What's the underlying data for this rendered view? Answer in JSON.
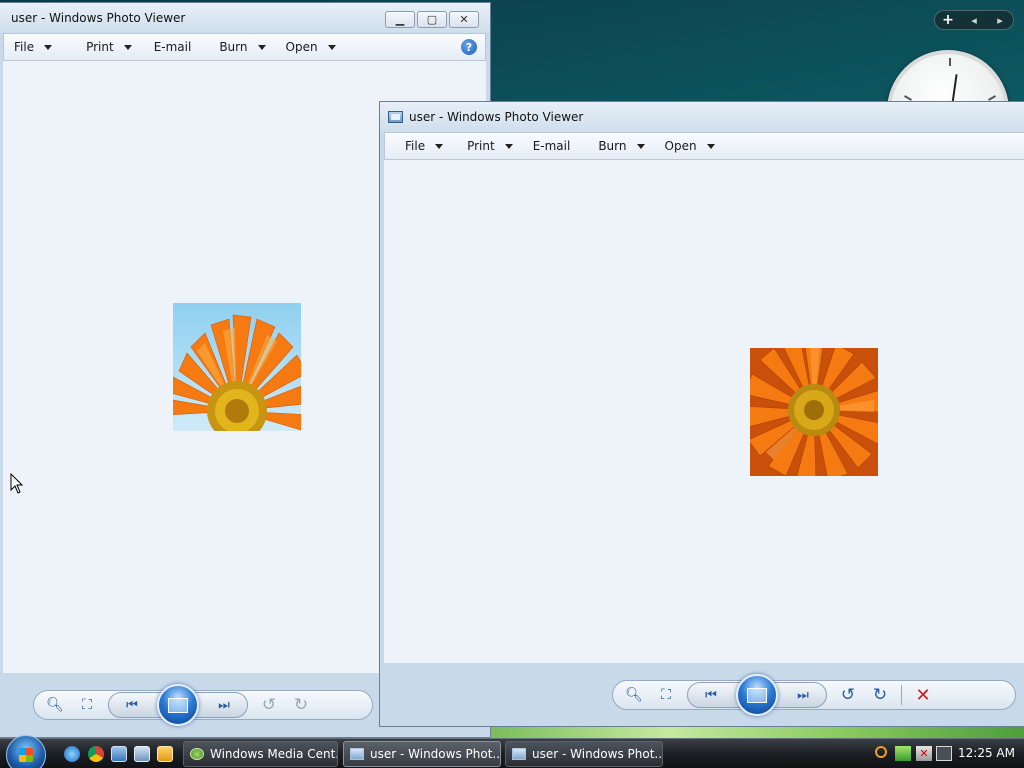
{
  "desktop": {
    "gadget_bar": {
      "add_label": "+",
      "prev_label": "◂",
      "next_label": "▸"
    }
  },
  "window_back": {
    "title": "user - Windows Photo Viewer",
    "menu": [
      {
        "label": "File"
      },
      {
        "label": "Print"
      },
      {
        "label": "E-mail"
      },
      {
        "label": "Burn"
      },
      {
        "label": "Open"
      }
    ],
    "help_label": "?"
  },
  "window_front": {
    "title": "user - Windows Photo Viewer",
    "menu": [
      {
        "label": "File"
      },
      {
        "label": "Print"
      },
      {
        "label": "E-mail"
      },
      {
        "label": "Burn"
      },
      {
        "label": "Open"
      }
    ]
  },
  "taskbar": {
    "buttons": [
      {
        "label": "Windows Media Cent..."
      },
      {
        "label": "user - Windows Phot..."
      },
      {
        "label": "user - Windows Phot..."
      }
    ],
    "time": "12:25 AM"
  },
  "colors": {
    "accent": "#2b7bd6",
    "delete": "#c81e1e",
    "viewer_bg": "#eef2f9",
    "flower_orange": "#f57a12",
    "flower_center": "#d8a818"
  }
}
